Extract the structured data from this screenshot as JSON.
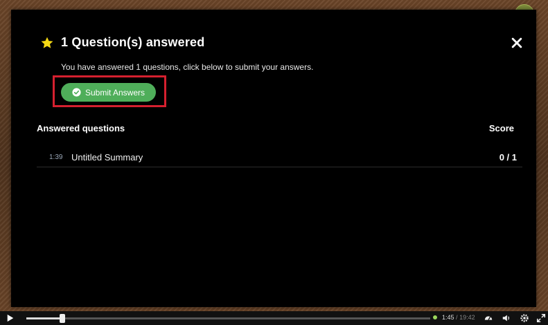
{
  "modal": {
    "title": "1 Question(s) answered",
    "description": "You have answered 1 questions, click below to submit your answers.",
    "submit_label": "Submit Answers",
    "star_icon": "star-icon",
    "close_icon": "close-icon"
  },
  "answered": {
    "header_questions": "Answered questions",
    "header_score": "Score",
    "items": [
      {
        "time": "1:39",
        "title": "Untitled Summary",
        "score": "0 / 1"
      }
    ]
  },
  "player": {
    "current_time": "1:45",
    "separator": "/",
    "total_time": "19:42",
    "progress": 0.089,
    "icons": [
      "play-icon",
      "speed-icon",
      "volume-icon",
      "settings-icon",
      "fullscreen-icon"
    ]
  },
  "colors": {
    "accent_green": "#4fae5a",
    "highlight_red": "#d5202f",
    "star_yellow": "#f5d914"
  }
}
